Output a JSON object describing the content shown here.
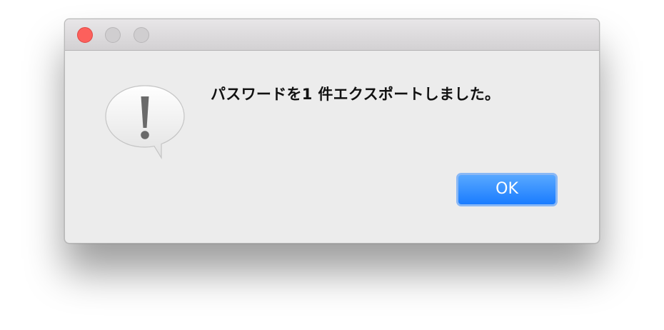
{
  "window": {
    "controls": {
      "close": "close-button",
      "minimize": "minimize-button",
      "zoom": "zoom-button"
    }
  },
  "alert": {
    "icon": "caution-speech-bubble-icon",
    "message": "パスワードを1 件エクスポートしました。",
    "ok_label": "OK"
  },
  "colors": {
    "dialog_bg": "#ececec",
    "close_light": "#fc605c",
    "button_blue": "#1a7cff"
  }
}
